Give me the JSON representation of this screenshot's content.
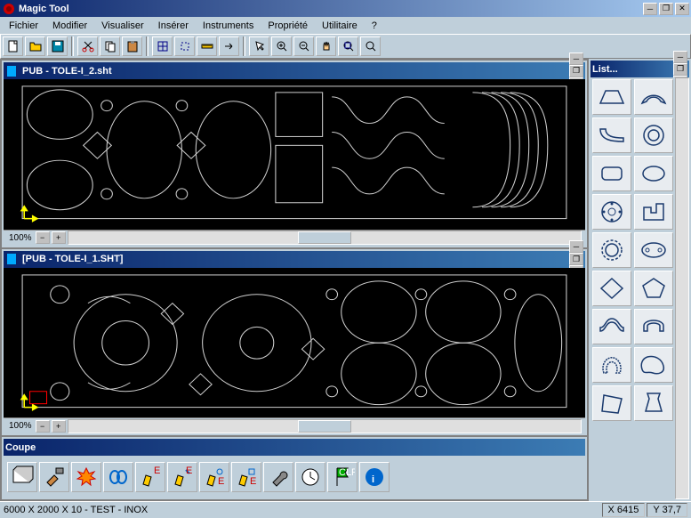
{
  "app": {
    "title": "Magic Tool"
  },
  "menu": [
    "Fichier",
    "Modifier",
    "Visualiser",
    "Insérer",
    "Instruments",
    "Propriété",
    "Utilitaire",
    "?"
  ],
  "docs": [
    {
      "title": "PUB - TOLE-I_2.sht",
      "zoom": "100%"
    },
    {
      "title": "[PUB - TOLE-I_1.SHT]",
      "zoom": "100%"
    }
  ],
  "panel": {
    "title": "List..."
  },
  "coupe": {
    "title": "Coupe"
  },
  "status": {
    "info": "6000 X 2000 X 10 - TEST - INOX",
    "x": "X 6415",
    "y": "Y 37,7"
  }
}
